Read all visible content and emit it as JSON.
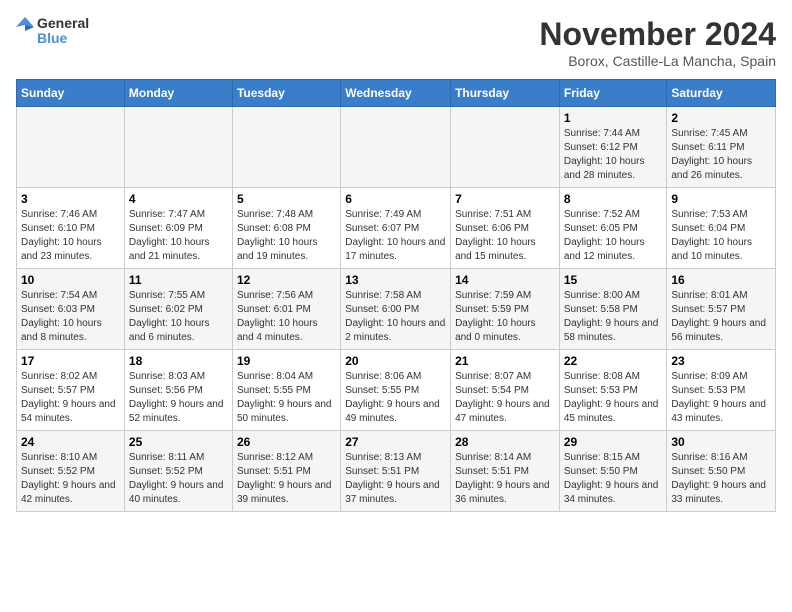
{
  "header": {
    "logo_line1": "General",
    "logo_line2": "Blue",
    "month_year": "November 2024",
    "location": "Borox, Castille-La Mancha, Spain"
  },
  "weekdays": [
    "Sunday",
    "Monday",
    "Tuesday",
    "Wednesday",
    "Thursday",
    "Friday",
    "Saturday"
  ],
  "weeks": [
    [
      {
        "day": "",
        "info": ""
      },
      {
        "day": "",
        "info": ""
      },
      {
        "day": "",
        "info": ""
      },
      {
        "day": "",
        "info": ""
      },
      {
        "day": "",
        "info": ""
      },
      {
        "day": "1",
        "info": "Sunrise: 7:44 AM\nSunset: 6:12 PM\nDaylight: 10 hours and 28 minutes."
      },
      {
        "day": "2",
        "info": "Sunrise: 7:45 AM\nSunset: 6:11 PM\nDaylight: 10 hours and 26 minutes."
      }
    ],
    [
      {
        "day": "3",
        "info": "Sunrise: 7:46 AM\nSunset: 6:10 PM\nDaylight: 10 hours and 23 minutes."
      },
      {
        "day": "4",
        "info": "Sunrise: 7:47 AM\nSunset: 6:09 PM\nDaylight: 10 hours and 21 minutes."
      },
      {
        "day": "5",
        "info": "Sunrise: 7:48 AM\nSunset: 6:08 PM\nDaylight: 10 hours and 19 minutes."
      },
      {
        "day": "6",
        "info": "Sunrise: 7:49 AM\nSunset: 6:07 PM\nDaylight: 10 hours and 17 minutes."
      },
      {
        "day": "7",
        "info": "Sunrise: 7:51 AM\nSunset: 6:06 PM\nDaylight: 10 hours and 15 minutes."
      },
      {
        "day": "8",
        "info": "Sunrise: 7:52 AM\nSunset: 6:05 PM\nDaylight: 10 hours and 12 minutes."
      },
      {
        "day": "9",
        "info": "Sunrise: 7:53 AM\nSunset: 6:04 PM\nDaylight: 10 hours and 10 minutes."
      }
    ],
    [
      {
        "day": "10",
        "info": "Sunrise: 7:54 AM\nSunset: 6:03 PM\nDaylight: 10 hours and 8 minutes."
      },
      {
        "day": "11",
        "info": "Sunrise: 7:55 AM\nSunset: 6:02 PM\nDaylight: 10 hours and 6 minutes."
      },
      {
        "day": "12",
        "info": "Sunrise: 7:56 AM\nSunset: 6:01 PM\nDaylight: 10 hours and 4 minutes."
      },
      {
        "day": "13",
        "info": "Sunrise: 7:58 AM\nSunset: 6:00 PM\nDaylight: 10 hours and 2 minutes."
      },
      {
        "day": "14",
        "info": "Sunrise: 7:59 AM\nSunset: 5:59 PM\nDaylight: 10 hours and 0 minutes."
      },
      {
        "day": "15",
        "info": "Sunrise: 8:00 AM\nSunset: 5:58 PM\nDaylight: 9 hours and 58 minutes."
      },
      {
        "day": "16",
        "info": "Sunrise: 8:01 AM\nSunset: 5:57 PM\nDaylight: 9 hours and 56 minutes."
      }
    ],
    [
      {
        "day": "17",
        "info": "Sunrise: 8:02 AM\nSunset: 5:57 PM\nDaylight: 9 hours and 54 minutes."
      },
      {
        "day": "18",
        "info": "Sunrise: 8:03 AM\nSunset: 5:56 PM\nDaylight: 9 hours and 52 minutes."
      },
      {
        "day": "19",
        "info": "Sunrise: 8:04 AM\nSunset: 5:55 PM\nDaylight: 9 hours and 50 minutes."
      },
      {
        "day": "20",
        "info": "Sunrise: 8:06 AM\nSunset: 5:55 PM\nDaylight: 9 hours and 49 minutes."
      },
      {
        "day": "21",
        "info": "Sunrise: 8:07 AM\nSunset: 5:54 PM\nDaylight: 9 hours and 47 minutes."
      },
      {
        "day": "22",
        "info": "Sunrise: 8:08 AM\nSunset: 5:53 PM\nDaylight: 9 hours and 45 minutes."
      },
      {
        "day": "23",
        "info": "Sunrise: 8:09 AM\nSunset: 5:53 PM\nDaylight: 9 hours and 43 minutes."
      }
    ],
    [
      {
        "day": "24",
        "info": "Sunrise: 8:10 AM\nSunset: 5:52 PM\nDaylight: 9 hours and 42 minutes."
      },
      {
        "day": "25",
        "info": "Sunrise: 8:11 AM\nSunset: 5:52 PM\nDaylight: 9 hours and 40 minutes."
      },
      {
        "day": "26",
        "info": "Sunrise: 8:12 AM\nSunset: 5:51 PM\nDaylight: 9 hours and 39 minutes."
      },
      {
        "day": "27",
        "info": "Sunrise: 8:13 AM\nSunset: 5:51 PM\nDaylight: 9 hours and 37 minutes."
      },
      {
        "day": "28",
        "info": "Sunrise: 8:14 AM\nSunset: 5:51 PM\nDaylight: 9 hours and 36 minutes."
      },
      {
        "day": "29",
        "info": "Sunrise: 8:15 AM\nSunset: 5:50 PM\nDaylight: 9 hours and 34 minutes."
      },
      {
        "day": "30",
        "info": "Sunrise: 8:16 AM\nSunset: 5:50 PM\nDaylight: 9 hours and 33 minutes."
      }
    ]
  ]
}
